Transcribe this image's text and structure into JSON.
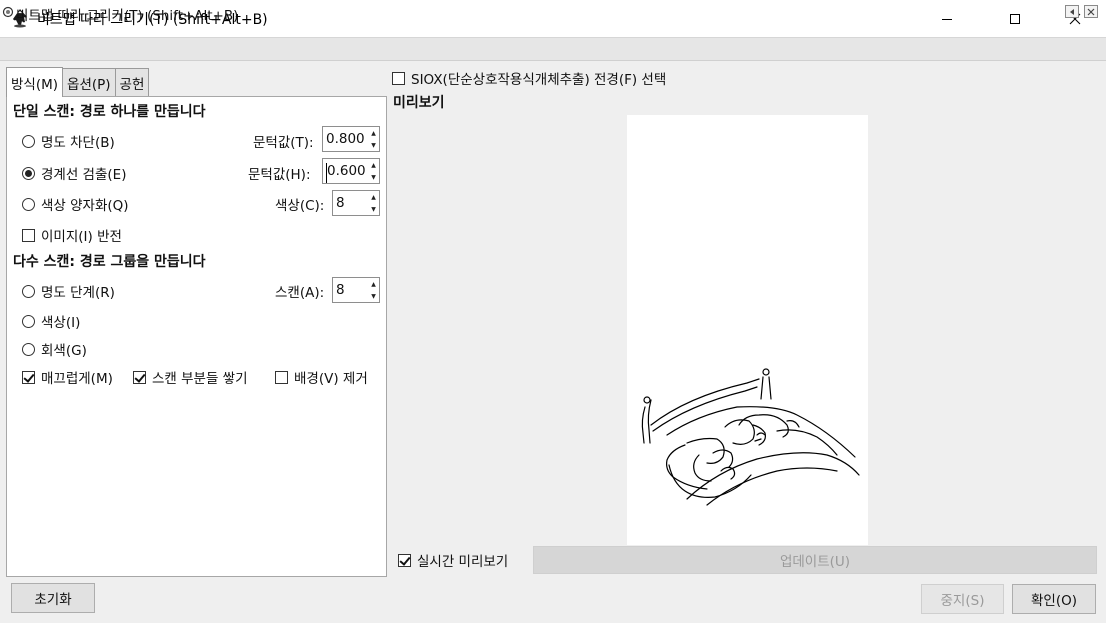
{
  "window": {
    "title": "비트맵 따라 그리기(T) (Shift+Alt+B)",
    "controls": [
      "minimize",
      "maximize",
      "close"
    ]
  },
  "dock": {
    "title": "비트맵 따라 그리기(T) (Shift+Alt+B)"
  },
  "tabs": [
    {
      "label": "방식(M)",
      "active": true
    },
    {
      "label": "옵션(P)",
      "active": false
    },
    {
      "label": "공헌",
      "active": false
    }
  ],
  "single_scan": {
    "heading": "단일 스캔: 경로 하나를 만듭니다",
    "brightness": {
      "label": "명도 차단(B)",
      "selected": false,
      "param_label": "문턱값(T):",
      "value": "0.800"
    },
    "edge": {
      "label": "경계선 검출(E)",
      "selected": true,
      "param_label": "문턱값(H):",
      "value": "0.600"
    },
    "color_quant": {
      "label": "색상 양자화(Q)",
      "selected": false,
      "param_label": "색상(C):",
      "value": "8"
    },
    "invert": {
      "label": "이미지(I) 반전",
      "checked": false
    }
  },
  "multi_scan": {
    "heading": "다수 스캔: 경로 그룹을 만듭니다",
    "brightness_steps": {
      "label": "명도 단계(R)",
      "selected": false,
      "param_label": "스캔(A):",
      "value": "8"
    },
    "colors": {
      "label": "색상(I)",
      "selected": false
    },
    "grays": {
      "label": "회색(G)",
      "selected": false
    },
    "smooth": {
      "label": "매끄럽게(M)",
      "checked": true
    },
    "stack": {
      "label": "스캔 부분들 쌓기",
      "checked": true
    },
    "remove_bg": {
      "label": "배경(V) 제거",
      "checked": false
    }
  },
  "siox": {
    "label": "SIOX(단순상호작용식개체추출) 전경(F) 선택",
    "checked": false
  },
  "preview": {
    "label": "미리보기",
    "live_label": "실시간 미리보기",
    "live_checked": true,
    "update_label": "업데이트(U)"
  },
  "buttons": {
    "reset": "초기화",
    "stop": "중지(S)",
    "ok": "확인(O)"
  },
  "colors": {
    "panel_bg": "#ffffff",
    "window_bg": "#efefef",
    "disabled_text": "#9a9a9a"
  }
}
